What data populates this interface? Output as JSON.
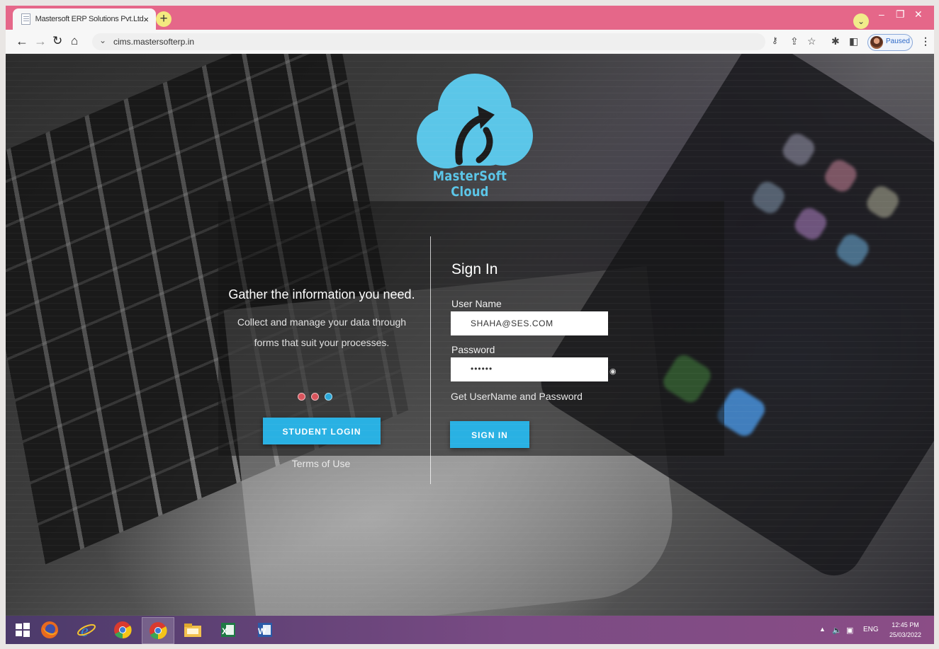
{
  "browser": {
    "tab_title": "Mastersoft ERP Solutions Pvt.Ltd",
    "tab_close": "×",
    "new_tab": "+",
    "url": "cims.mastersofterp.in",
    "profile_status": "Paused",
    "window_controls": {
      "minimize": "–",
      "restore": "❐",
      "close": "✕"
    },
    "accent": "#e56789"
  },
  "brand": {
    "name": "MasterSoft Cloud",
    "color": "#5bc6e8"
  },
  "promo": {
    "headline": "Gather the information you need.",
    "subtext_line1": "Collect and manage your data through",
    "subtext_line2": "forms that suit your processes.",
    "slider_dots": [
      "#d9545c",
      "#d9545c",
      "#2aa7d8"
    ],
    "student_login": "STUDENT LOGIN",
    "terms": "Terms of Use"
  },
  "signin": {
    "title": "Sign In",
    "username_label": "User Name",
    "username_value": "SHAHA@SES.COM",
    "password_label": "Password",
    "password_value": "••••••",
    "get_credentials": "Get UserName and Password",
    "submit": "SIGN IN",
    "button_color": "#29b1e3"
  },
  "taskbar": {
    "apps": [
      "start-icon",
      "firefox-icon",
      "internet-explorer-icon",
      "chrome-icon",
      "chrome-active-icon",
      "file-explorer-icon",
      "excel-icon",
      "word-icon"
    ],
    "language": "ENG",
    "time": "12:45 PM",
    "date": "25/03/2022"
  }
}
